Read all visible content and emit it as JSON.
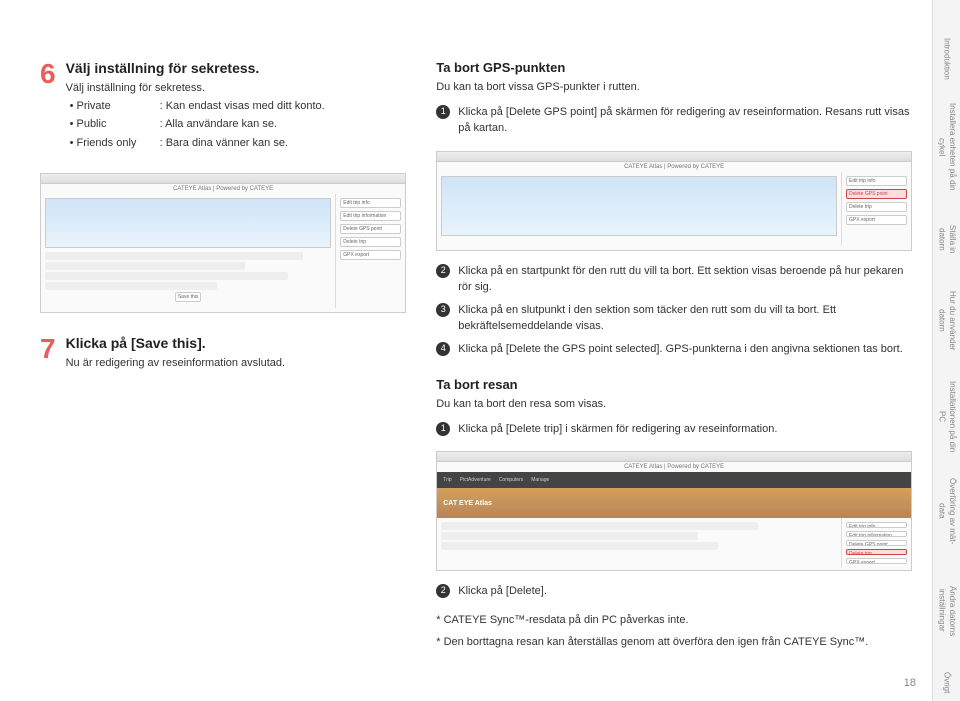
{
  "page_number": "18",
  "left": {
    "step6": {
      "num": "6",
      "title": "Välj inställning för sekretess.",
      "text": "Välj inställning för sekretess.",
      "bullets": [
        {
          "opt": "• Private",
          "desc": ": Kan endast visas med ditt konto."
        },
        {
          "opt": "• Public",
          "desc": ": Alla användare kan se."
        },
        {
          "opt": "• Friends only",
          "desc": ": Bara dina vänner kan se."
        }
      ]
    },
    "step7": {
      "num": "7",
      "title": "Klicka på [Save this].",
      "text": "Nu är redigering av reseinformation avslutad."
    }
  },
  "right": {
    "section1": {
      "heading": "Ta bort GPS-punkten",
      "intro": "Du kan ta bort vissa GPS-punkter i rutten.",
      "n1": "Klicka på [Delete GPS point] på skärmen för redigering av reseinformation. Resans rutt visas på kartan.",
      "n2": "Klicka på en startpunkt för den rutt du vill ta bort. Ett sektion visas beroende på hur pekaren rör sig.",
      "n3": "Klicka på en slutpunkt i den sektion som täcker den rutt som du vill ta bort. Ett bekräftelsemeddelande visas.",
      "n4": "Klicka på [Delete the GPS point selected]. GPS-punkterna i den angivna sektionen tas bort."
    },
    "section2": {
      "heading": "Ta bort resan",
      "intro": "Du kan ta bort den resa som visas.",
      "n1": "Klicka på [Delete trip] i skärmen för redigering av reseinformation.",
      "n2": "Klicka på [Delete].",
      "note1": "* CATEYE Sync™-resdata på din PC påverkas inte.",
      "note2": "* Den borttagna resan kan återställas genom att överföra den igen från CATEYE Sync™."
    }
  },
  "screenshots": {
    "atlas_title": "CATEYE Atlas | Powered by CATEYE",
    "btn_edit": "Edit trip info",
    "btn_editinfo": "Edit trip information",
    "btn_delgps": "Delete GPS point",
    "btn_deltrip": "Delete trip",
    "btn_gpx": "GPX export",
    "btn_save": "Save this",
    "nav": [
      "Trip",
      "PictAdventure",
      "Computers",
      "Manage"
    ],
    "hero_logo": "CAT EYE Atlas"
  },
  "sidebar": [
    "Introduktion",
    "Installera enheten på din cykel",
    "Ställa in datorn",
    "Hur du använder datorn",
    "Installationen på din PC",
    "Överföring av mät-data",
    "Ändra datorns inställningar",
    "Övrigt"
  ]
}
